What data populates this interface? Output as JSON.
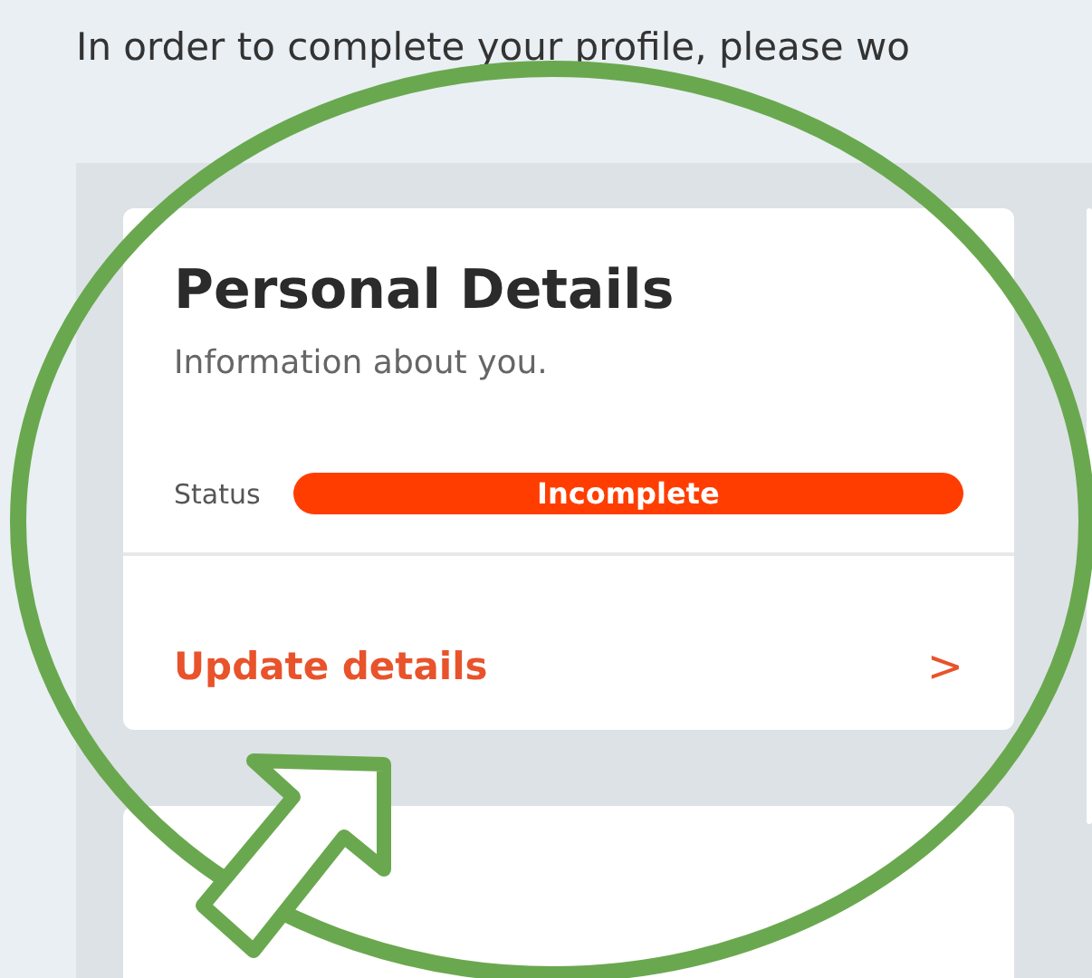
{
  "intro": "In order to complete your profile, please wo",
  "card": {
    "title": "Personal Details",
    "subtitle": "Information about you.",
    "status_label": "Status",
    "status": "Incomplete",
    "complete": false,
    "action": "Update details",
    "chevron": ">"
  }
}
